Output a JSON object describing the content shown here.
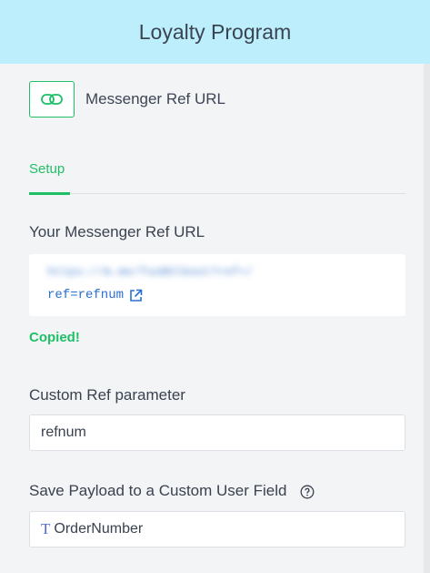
{
  "header": {
    "title": "Loyalty Program"
  },
  "node": {
    "label": "Messenger Ref URL",
    "icon": "link-icon"
  },
  "tabs": [
    {
      "label": "Setup",
      "active": true
    }
  ],
  "ref_url": {
    "heading": "Your Messenger Ref URL",
    "blurred_line": "https://m.me/fooBOlboot?ref=/",
    "param_text": "ref=refnum",
    "copied_text": "Copied!"
  },
  "custom_ref": {
    "label": "Custom Ref parameter",
    "value": "refnum"
  },
  "payload_field": {
    "label": "Save Payload to a Custom User Field",
    "type_icon": "T",
    "value": "OrderNumber"
  },
  "colors": {
    "accent": "#1fbf66",
    "header_bg": "#bdeefb",
    "link": "#2a6fd0"
  }
}
